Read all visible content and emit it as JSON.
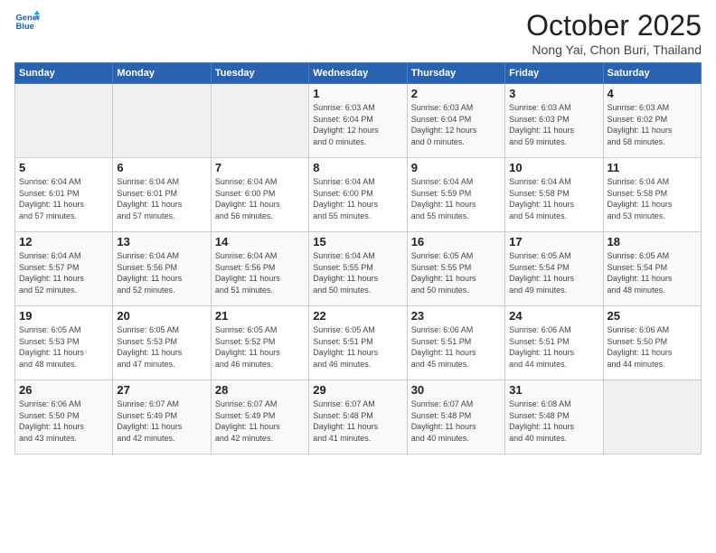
{
  "header": {
    "logo_line1": "General",
    "logo_line2": "Blue",
    "month": "October 2025",
    "location": "Nong Yai, Chon Buri, Thailand"
  },
  "weekdays": [
    "Sunday",
    "Monday",
    "Tuesday",
    "Wednesday",
    "Thursday",
    "Friday",
    "Saturday"
  ],
  "weeks": [
    [
      {
        "day": "",
        "info": ""
      },
      {
        "day": "",
        "info": ""
      },
      {
        "day": "",
        "info": ""
      },
      {
        "day": "1",
        "info": "Sunrise: 6:03 AM\nSunset: 6:04 PM\nDaylight: 12 hours\nand 0 minutes."
      },
      {
        "day": "2",
        "info": "Sunrise: 6:03 AM\nSunset: 6:04 PM\nDaylight: 12 hours\nand 0 minutes."
      },
      {
        "day": "3",
        "info": "Sunrise: 6:03 AM\nSunset: 6:03 PM\nDaylight: 11 hours\nand 59 minutes."
      },
      {
        "day": "4",
        "info": "Sunrise: 6:03 AM\nSunset: 6:02 PM\nDaylight: 11 hours\nand 58 minutes."
      }
    ],
    [
      {
        "day": "5",
        "info": "Sunrise: 6:04 AM\nSunset: 6:01 PM\nDaylight: 11 hours\nand 57 minutes."
      },
      {
        "day": "6",
        "info": "Sunrise: 6:04 AM\nSunset: 6:01 PM\nDaylight: 11 hours\nand 57 minutes."
      },
      {
        "day": "7",
        "info": "Sunrise: 6:04 AM\nSunset: 6:00 PM\nDaylight: 11 hours\nand 56 minutes."
      },
      {
        "day": "8",
        "info": "Sunrise: 6:04 AM\nSunset: 6:00 PM\nDaylight: 11 hours\nand 55 minutes."
      },
      {
        "day": "9",
        "info": "Sunrise: 6:04 AM\nSunset: 5:59 PM\nDaylight: 11 hours\nand 55 minutes."
      },
      {
        "day": "10",
        "info": "Sunrise: 6:04 AM\nSunset: 5:58 PM\nDaylight: 11 hours\nand 54 minutes."
      },
      {
        "day": "11",
        "info": "Sunrise: 6:04 AM\nSunset: 5:58 PM\nDaylight: 11 hours\nand 53 minutes."
      }
    ],
    [
      {
        "day": "12",
        "info": "Sunrise: 6:04 AM\nSunset: 5:57 PM\nDaylight: 11 hours\nand 52 minutes."
      },
      {
        "day": "13",
        "info": "Sunrise: 6:04 AM\nSunset: 5:56 PM\nDaylight: 11 hours\nand 52 minutes."
      },
      {
        "day": "14",
        "info": "Sunrise: 6:04 AM\nSunset: 5:56 PM\nDaylight: 11 hours\nand 51 minutes."
      },
      {
        "day": "15",
        "info": "Sunrise: 6:04 AM\nSunset: 5:55 PM\nDaylight: 11 hours\nand 50 minutes."
      },
      {
        "day": "16",
        "info": "Sunrise: 6:05 AM\nSunset: 5:55 PM\nDaylight: 11 hours\nand 50 minutes."
      },
      {
        "day": "17",
        "info": "Sunrise: 6:05 AM\nSunset: 5:54 PM\nDaylight: 11 hours\nand 49 minutes."
      },
      {
        "day": "18",
        "info": "Sunrise: 6:05 AM\nSunset: 5:54 PM\nDaylight: 11 hours\nand 48 minutes."
      }
    ],
    [
      {
        "day": "19",
        "info": "Sunrise: 6:05 AM\nSunset: 5:53 PM\nDaylight: 11 hours\nand 48 minutes."
      },
      {
        "day": "20",
        "info": "Sunrise: 6:05 AM\nSunset: 5:53 PM\nDaylight: 11 hours\nand 47 minutes."
      },
      {
        "day": "21",
        "info": "Sunrise: 6:05 AM\nSunset: 5:52 PM\nDaylight: 11 hours\nand 46 minutes."
      },
      {
        "day": "22",
        "info": "Sunrise: 6:05 AM\nSunset: 5:51 PM\nDaylight: 11 hours\nand 46 minutes."
      },
      {
        "day": "23",
        "info": "Sunrise: 6:06 AM\nSunset: 5:51 PM\nDaylight: 11 hours\nand 45 minutes."
      },
      {
        "day": "24",
        "info": "Sunrise: 6:06 AM\nSunset: 5:51 PM\nDaylight: 11 hours\nand 44 minutes."
      },
      {
        "day": "25",
        "info": "Sunrise: 6:06 AM\nSunset: 5:50 PM\nDaylight: 11 hours\nand 44 minutes."
      }
    ],
    [
      {
        "day": "26",
        "info": "Sunrise: 6:06 AM\nSunset: 5:50 PM\nDaylight: 11 hours\nand 43 minutes."
      },
      {
        "day": "27",
        "info": "Sunrise: 6:07 AM\nSunset: 5:49 PM\nDaylight: 11 hours\nand 42 minutes."
      },
      {
        "day": "28",
        "info": "Sunrise: 6:07 AM\nSunset: 5:49 PM\nDaylight: 11 hours\nand 42 minutes."
      },
      {
        "day": "29",
        "info": "Sunrise: 6:07 AM\nSunset: 5:48 PM\nDaylight: 11 hours\nand 41 minutes."
      },
      {
        "day": "30",
        "info": "Sunrise: 6:07 AM\nSunset: 5:48 PM\nDaylight: 11 hours\nand 40 minutes."
      },
      {
        "day": "31",
        "info": "Sunrise: 6:08 AM\nSunset: 5:48 PM\nDaylight: 11 hours\nand 40 minutes."
      },
      {
        "day": "",
        "info": ""
      }
    ]
  ]
}
